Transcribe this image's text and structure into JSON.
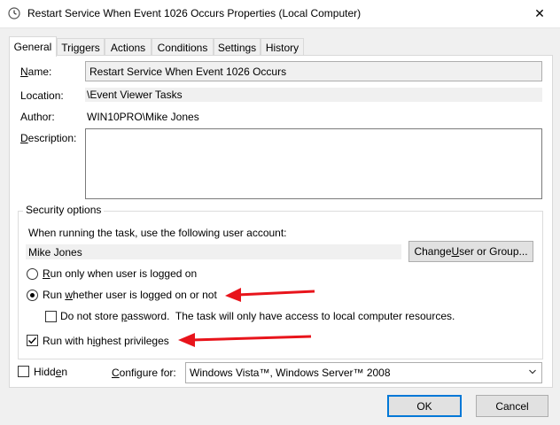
{
  "window": {
    "title": "Restart Service When Event 1026 Occurs Properties (Local Computer)",
    "close_glyph": "✕"
  },
  "tabs": [
    {
      "label": "General",
      "active": true
    },
    {
      "label": "Triggers"
    },
    {
      "label": "Actions"
    },
    {
      "label": "Conditions"
    },
    {
      "label": "Settings"
    },
    {
      "label": "History"
    }
  ],
  "general": {
    "name_label": "Name:",
    "name_value": "Restart Service When Event 1026 Occurs",
    "location_label": "Location:",
    "location_value": "\\Event Viewer Tasks",
    "author_label": "Author:",
    "author_value": "WIN10PRO\\Mike Jones",
    "description_label": "Description:",
    "description_value": ""
  },
  "security": {
    "group_title": "Security options",
    "account_prompt": "When running the task, use the following user account:",
    "account_value": "Mike Jones",
    "change_user_button": "Change User or Group...",
    "radio_logged_on": "Run only when user is logged on",
    "radio_whether": "Run whether user is logged on or not",
    "radio_selected": "whether",
    "no_store_password": "Do not store password.  The task will only have access to local computer resources.",
    "no_store_password_checked": false,
    "highest_privileges": "Run with highest privileges",
    "highest_privileges_checked": true
  },
  "bottom": {
    "hidden_label": "Hidden",
    "hidden_checked": false,
    "configure_label": "Configure for:",
    "configure_value": "Windows Vista™, Windows Server™ 2008"
  },
  "buttons": {
    "ok": "OK",
    "cancel": "Cancel"
  },
  "colors": {
    "annotation_arrow": "#e8141b",
    "focus_border": "#0078d7"
  },
  "icons": {
    "title_icon": "clock-icon",
    "close": "close-icon",
    "combo_chevron": "chevron-down-icon",
    "arrow": "red-arrow-icon"
  }
}
